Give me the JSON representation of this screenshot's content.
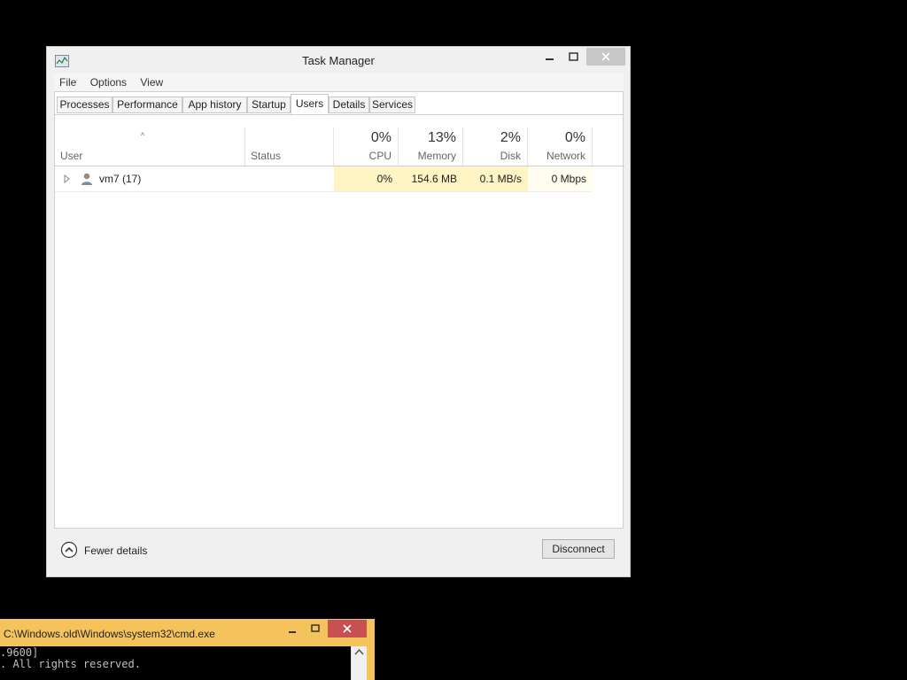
{
  "task_manager": {
    "title": "Task Manager",
    "controls": {
      "minimize": "—",
      "maximize": "▢",
      "close": "✕"
    },
    "menu": [
      "File",
      "Options",
      "View"
    ],
    "tabs": [
      {
        "label": "Processes",
        "active": false
      },
      {
        "label": "Performance",
        "active": false
      },
      {
        "label": "App history",
        "active": false
      },
      {
        "label": "Startup",
        "active": false
      },
      {
        "label": "Users",
        "active": true
      },
      {
        "label": "Details",
        "active": false
      },
      {
        "label": "Services",
        "active": false
      }
    ],
    "columns": {
      "user": {
        "label": "User",
        "sort_indicator": "^"
      },
      "status": {
        "label": "Status"
      },
      "cpu": {
        "label": "CPU",
        "total": "0%"
      },
      "memory": {
        "label": "Memory",
        "total": "13%"
      },
      "disk": {
        "label": "Disk",
        "total": "2%"
      },
      "network": {
        "label": "Network",
        "total": "0%"
      }
    },
    "rows": [
      {
        "user": "vm7 (17)",
        "status": "",
        "cpu": "0%",
        "memory": "154.6 MB",
        "disk": "0.1 MB/s",
        "network": "0 Mbps",
        "icon": "user-icon"
      }
    ],
    "footer": {
      "fewer_details": "Fewer details",
      "disconnect": "Disconnect"
    }
  },
  "cmd_window": {
    "title": "C:\\Windows.old\\Windows\\system32\\cmd.exe",
    "controls": {
      "minimize": "—",
      "maximize": "▢",
      "close": "✕"
    },
    "lines": [
      ".9600]",
      ". All rights reserved."
    ]
  },
  "colors": {
    "desktop": "#000000",
    "cmd_titlebar": "#f4c35c",
    "cmd_close": "#c75050",
    "highlight_cells": "#fff4c4"
  }
}
